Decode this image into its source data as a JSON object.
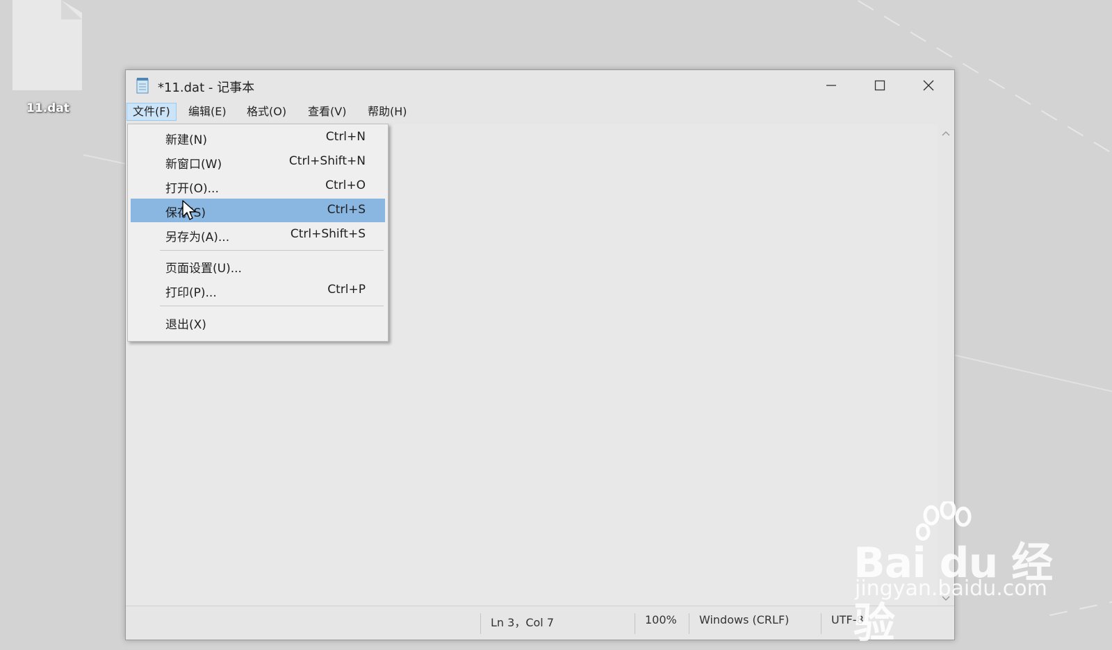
{
  "desktop": {
    "file_label": "11.dat"
  },
  "window": {
    "title": "*11.dat - 记事本",
    "controls": {
      "minimize": "minimize-icon",
      "maximize": "maximize-icon",
      "close": "close-icon"
    }
  },
  "menubar": {
    "items": [
      {
        "label": "文件(F)",
        "active": true
      },
      {
        "label": "编辑(E)"
      },
      {
        "label": "格式(O)"
      },
      {
        "label": "查看(V)"
      },
      {
        "label": "帮助(H)"
      }
    ]
  },
  "file_menu": {
    "items": [
      {
        "label": "新建(N)",
        "shortcut": "Ctrl+N"
      },
      {
        "label": "新窗口(W)",
        "shortcut": "Ctrl+Shift+N"
      },
      {
        "label": "打开(O)...",
        "shortcut": "Ctrl+O"
      },
      {
        "label": "保存(S)",
        "shortcut": "Ctrl+S",
        "highlighted": true
      },
      {
        "label": "另存为(A)...",
        "shortcut": "Ctrl+Shift+S"
      },
      {
        "label": "页面设置(U)...",
        "shortcut": ""
      },
      {
        "label": "打印(P)...",
        "shortcut": "Ctrl+P"
      },
      {
        "label": "退出(X)",
        "shortcut": ""
      }
    ]
  },
  "statusbar": {
    "position": "Ln 3，Col 7",
    "zoom": "100%",
    "line_ending": "Windows (CRLF)",
    "encoding": "UTF-8"
  },
  "watermark": {
    "brand": "Bai du 经验",
    "url": "jingyan.baidu.com"
  },
  "colors": {
    "menu_highlight": "#8ab6e2",
    "menubar_active": "#cce4f7"
  }
}
